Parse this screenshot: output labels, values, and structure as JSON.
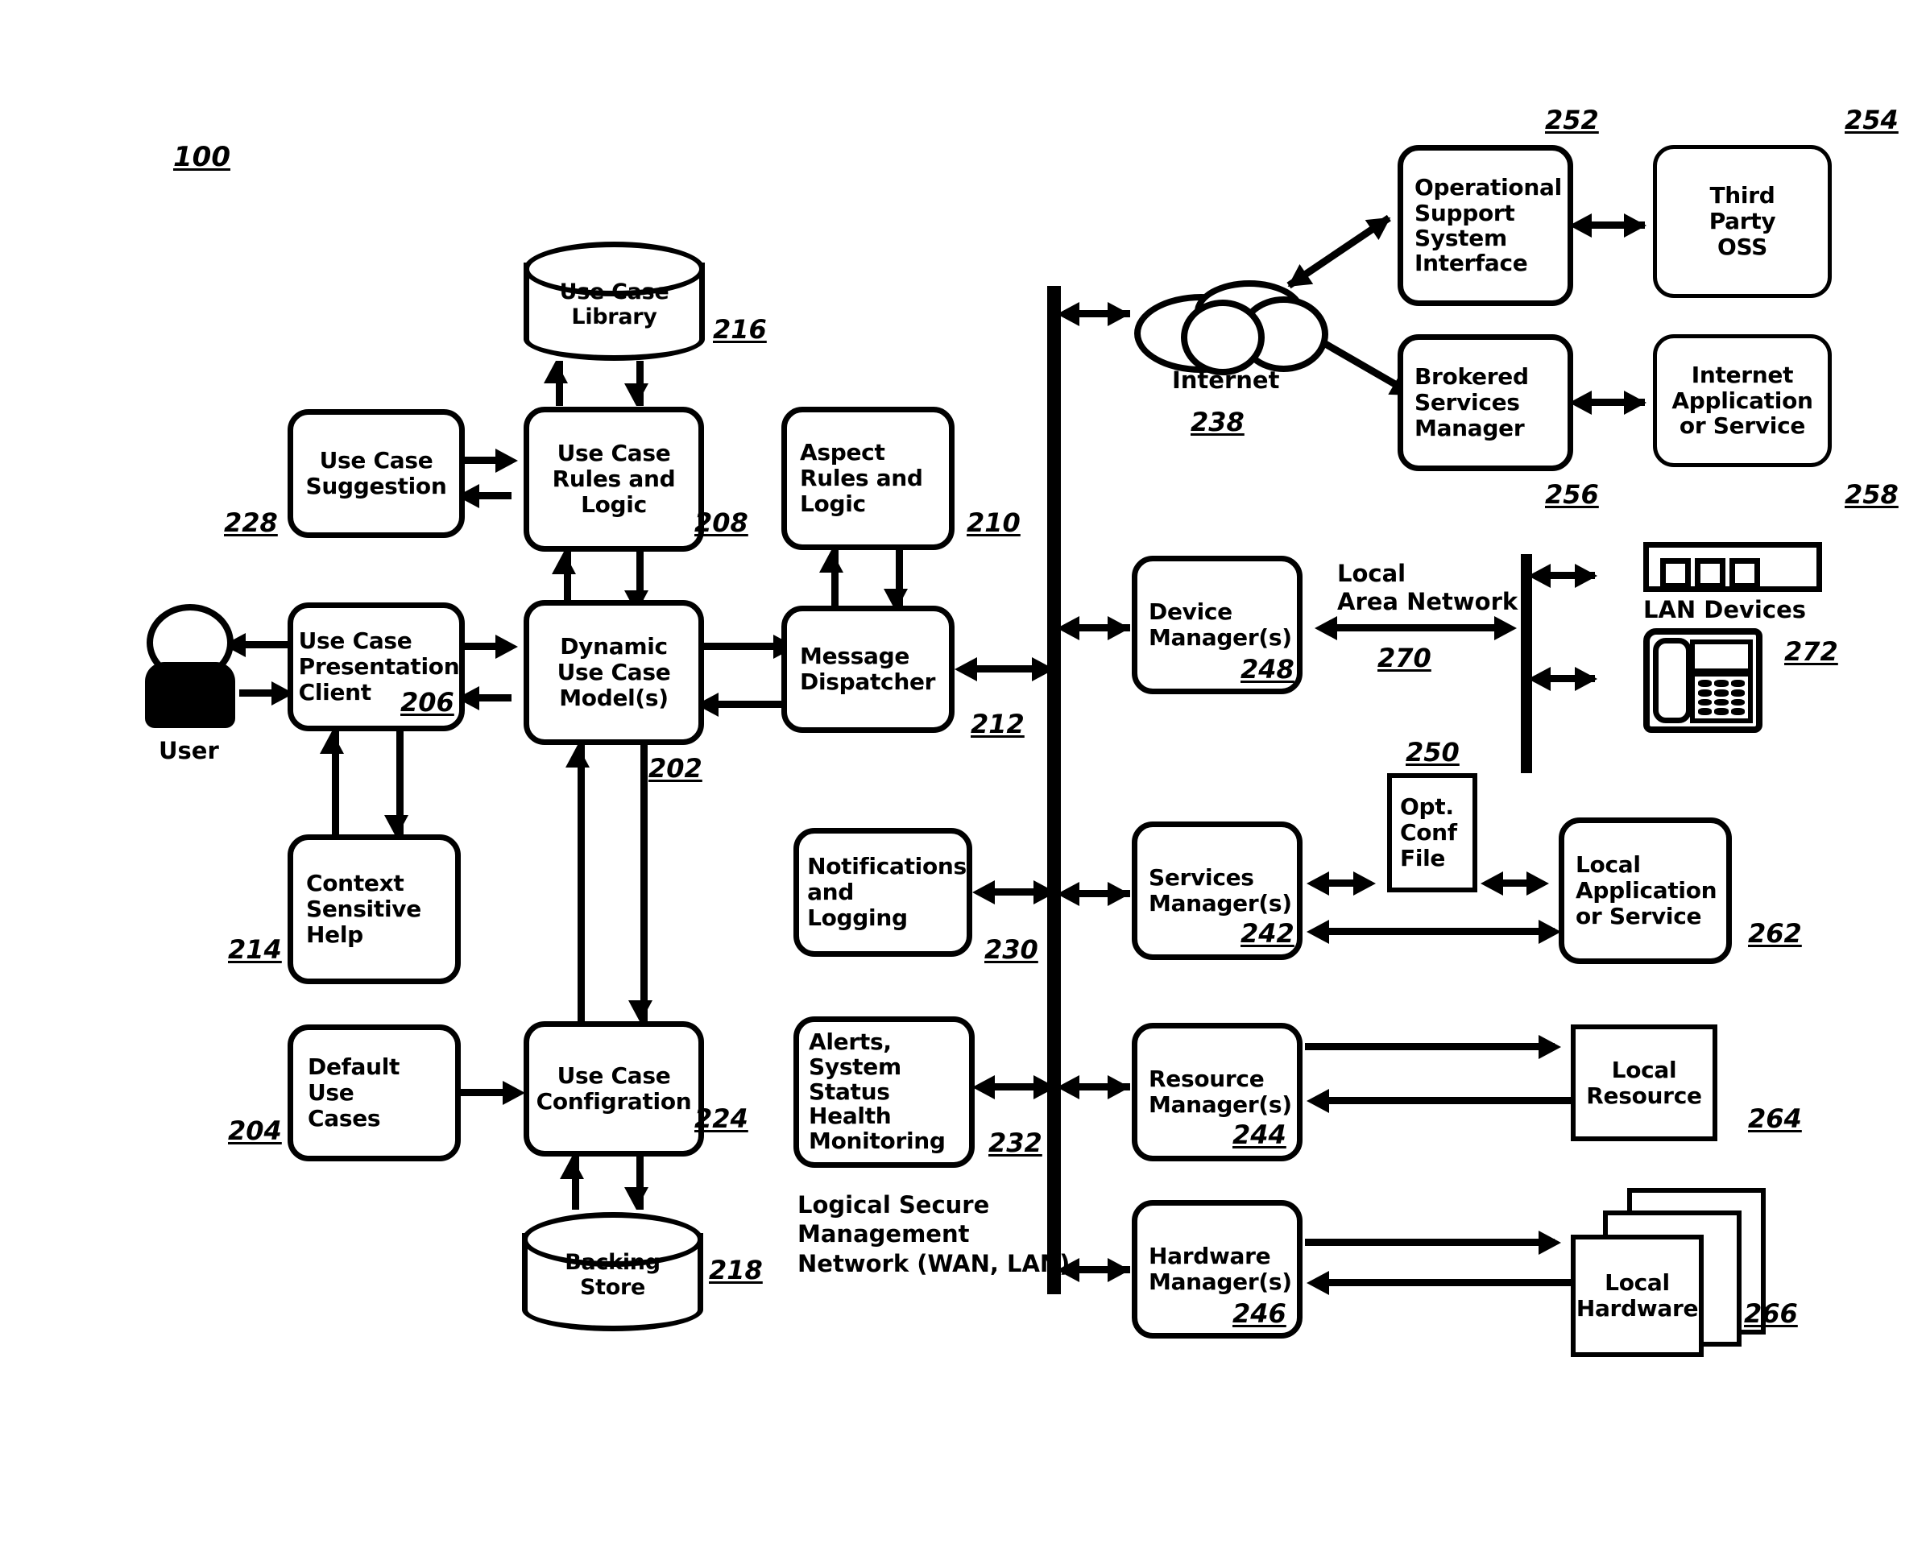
{
  "figure": {
    "number": "100"
  },
  "nodes": {
    "use_case_library": {
      "label": "Use Case\nLibrary",
      "ref": "216"
    },
    "use_case_suggestion": {
      "label": "Use Case\nSuggestion",
      "ref": "228"
    },
    "use_case_rules_logic": {
      "label": "Use Case\nRules and\nLogic",
      "ref": "208"
    },
    "aspect_rules_logic": {
      "label": "Aspect\nRules and\nLogic",
      "ref": "210"
    },
    "use_case_presentation": {
      "label": "Use Case\nPresentation\nClient",
      "ref": "206"
    },
    "dynamic_use_case_model": {
      "label": "Dynamic\nUse Case\nModel(s)",
      "ref": "202"
    },
    "message_dispatcher": {
      "label": "Message\nDispatcher",
      "ref": "212"
    },
    "context_sensitive_help": {
      "label": "Context\nSensitive\nHelp",
      "ref": "214"
    },
    "default_use_cases": {
      "label": "Default\nUse\nCases",
      "ref": "204"
    },
    "use_case_configration": {
      "label": "Use Case\nConfigration",
      "ref": "224"
    },
    "backing_store": {
      "label": "Backing\nStore",
      "ref": "218"
    },
    "notifications_logging": {
      "label": "Notifications\nand\nLogging",
      "ref": "230"
    },
    "alerts_status_health": {
      "label": "Alerts,\nSystem Status\nHealth\nMonitoring",
      "ref": "232"
    },
    "internet": {
      "label": "Internet",
      "ref": "238"
    },
    "oss_interface": {
      "label": "Operational\nSupport\nSystem\nInterface",
      "ref": "252"
    },
    "third_party_oss": {
      "label": "Third\nParty\nOSS",
      "ref": "254"
    },
    "brokered_services_mgr": {
      "label": "Brokered\nServices\nManager",
      "ref": "256"
    },
    "internet_app_service": {
      "label": "Internet\nApplication\nor Service",
      "ref": "258"
    },
    "device_managers": {
      "label": "Device\nManager(s)",
      "ref": "248"
    },
    "lan_devices": {
      "label": "LAN Devices",
      "ref": "272"
    },
    "services_managers": {
      "label": "Services\nManager(s)",
      "ref": "242"
    },
    "opt_conf_file": {
      "label": "Opt.\nConf\nFile",
      "ref": "250"
    },
    "local_app_service": {
      "label": "Local\nApplication\nor Service",
      "ref": "262"
    },
    "resource_managers": {
      "label": "Resource\nManager(s)",
      "ref": "244"
    },
    "local_resource": {
      "label": "Local\nResource",
      "ref": "264"
    },
    "hardware_managers": {
      "label": "Hardware\nManager(s)",
      "ref": "246"
    },
    "local_hardware": {
      "label": "Local\nHardware",
      "ref": "266"
    }
  },
  "captions": {
    "user": "User",
    "local_area_network": "Local\nArea Network",
    "local_area_network_ref": "270",
    "logical_secure_network": "Logical Secure\nManagement\nNetwork (WAN, LAN)"
  },
  "colors": {
    "ink": "#000000",
    "paper": "#ffffff"
  }
}
